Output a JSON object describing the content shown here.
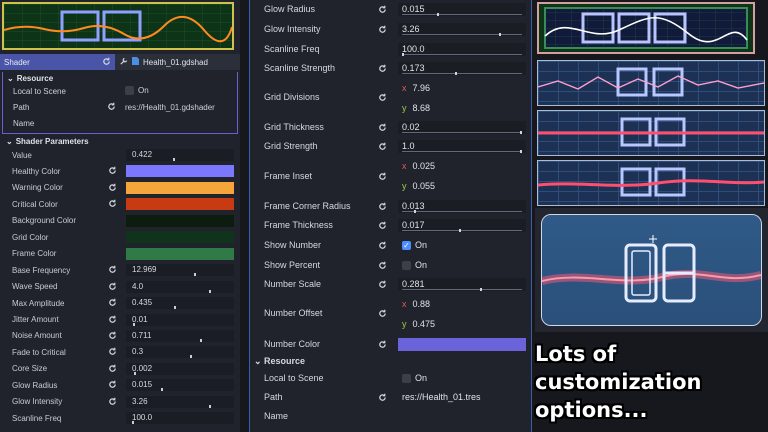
{
  "left_panel": {
    "tab_label": "Shader",
    "file_label": "Health_01.gdshad",
    "resource": {
      "header": "Resource",
      "local_to_scene_label": "Local to Scene",
      "local_to_scene_value": "On",
      "path_label": "Path",
      "path_value": "res://Health_01.gdshader",
      "name_label": "Name"
    },
    "params_header": "Shader Parameters",
    "params": [
      {
        "label": "Value",
        "value": "0.422",
        "kind": "number",
        "fill": 0.422
      },
      {
        "label": "Healthy Color",
        "kind": "color",
        "color": "#7b78ff"
      },
      {
        "label": "Warning Color",
        "kind": "color",
        "color": "#f6a53a"
      },
      {
        "label": "Critical Color",
        "kind": "color",
        "color": "#c83b12"
      },
      {
        "label": "Background Color",
        "kind": "color",
        "color": "#0c1d10"
      },
      {
        "label": "Grid Color",
        "kind": "color",
        "color": "#10331c"
      },
      {
        "label": "Frame Color",
        "kind": "color",
        "color": "#2f7a46"
      },
      {
        "label": "Base Frequency",
        "value": "12.969",
        "kind": "number",
        "fill": 0.65
      },
      {
        "label": "Wave Speed",
        "value": "4.0",
        "kind": "number",
        "fill": 0.8
      },
      {
        "label": "Max Amplitude",
        "value": "0.435",
        "kind": "number",
        "fill": 0.435
      },
      {
        "label": "Jitter Amount",
        "value": "0.01",
        "kind": "number",
        "fill": 0.01
      },
      {
        "label": "Noise Amount",
        "value": "0.711",
        "kind": "number",
        "fill": 0.711
      },
      {
        "label": "Fade to Critical",
        "value": "0.3",
        "kind": "number",
        "fill": 0.6
      },
      {
        "label": "Core Size",
        "value": "0.002",
        "kind": "number",
        "fill": 0.02
      },
      {
        "label": "Glow Radius",
        "value": "0.015",
        "kind": "number",
        "fill": 0.3
      },
      {
        "label": "Glow Intensity",
        "value": "3.26",
        "kind": "number",
        "fill": 0.8
      },
      {
        "label": "Scanline Freq",
        "value": "100.0",
        "kind": "number",
        "fill": 0.0
      }
    ]
  },
  "mid_panel": {
    "rows": [
      {
        "label": "Glow Radius",
        "value": "0.015",
        "fill": 0.3
      },
      {
        "label": "Glow Intensity",
        "value": "3.26",
        "fill": 0.82
      },
      {
        "label": "Scanline Freq",
        "value": "100.0",
        "fill": 0.0
      },
      {
        "label": "Scanline Strength",
        "value": "0.173",
        "fill": 0.45
      }
    ],
    "grid_divisions": {
      "label": "Grid Divisions",
      "x": "7.96",
      "y": "8.68"
    },
    "grid_thickness": {
      "label": "Grid Thickness",
      "value": "0.02",
      "fill": 1.0
    },
    "grid_strength": {
      "label": "Grid Strength",
      "value": "1.0",
      "fill": 1.0
    },
    "frame_inset": {
      "label": "Frame Inset",
      "x": "0.025",
      "y": "0.055"
    },
    "frame_corner_radius": {
      "label": "Frame Corner Radius",
      "value": "0.013",
      "fill": 0.1
    },
    "frame_thickness": {
      "label": "Frame Thickness",
      "value": "0.017",
      "fill": 0.48
    },
    "show_number": {
      "label": "Show Number",
      "value": "On",
      "checked": true
    },
    "show_percent": {
      "label": "Show Percent",
      "value": "On",
      "checked": false
    },
    "number_scale": {
      "label": "Number Scale",
      "value": "0.281",
      "fill": 0.66
    },
    "number_offset": {
      "label": "Number Offset",
      "x": "0.88",
      "y": "0.475"
    },
    "number_color": {
      "label": "Number Color",
      "color": "#6a63d9"
    },
    "resource": {
      "header": "Resource",
      "local_to_scene_label": "Local to Scene",
      "local_to_scene_value": "On",
      "path_label": "Path",
      "path_value": "res://Health_01.tres",
      "name_label": "Name"
    }
  },
  "caption": {
    "line1": "Lots of customization",
    "line2": "options..."
  }
}
